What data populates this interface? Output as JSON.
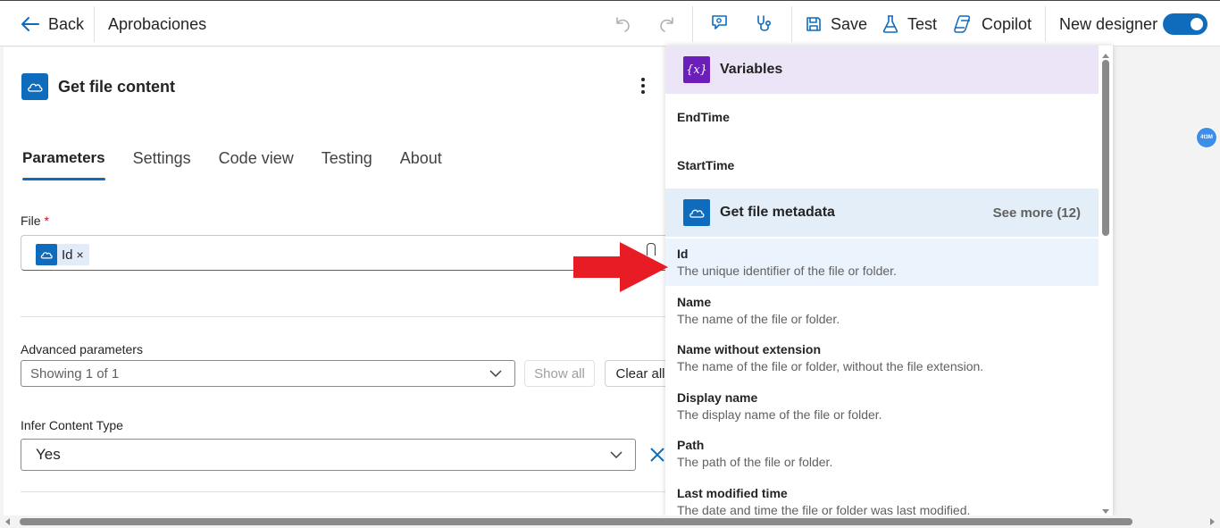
{
  "topbar": {
    "back_label": "Back",
    "title": "Aprobaciones",
    "save_label": "Save",
    "test_label": "Test",
    "copilot_label": "Copilot",
    "new_designer_label": "New designer",
    "new_designer_on": true
  },
  "card": {
    "title": "Get file content",
    "tabs": [
      {
        "label": "Parameters",
        "active": true
      },
      {
        "label": "Settings",
        "active": false
      },
      {
        "label": "Code view",
        "active": false
      },
      {
        "label": "Testing",
        "active": false
      },
      {
        "label": "About",
        "active": false
      }
    ],
    "file_label": "File",
    "file_required": "*",
    "file_token": "Id",
    "file_token_remove": "×",
    "advanced_label": "Advanced parameters",
    "advanced_value": "Showing 1 of 1",
    "show_all": "Show all",
    "clear_all": "Clear all",
    "infer_label": "Infer Content Type",
    "infer_value": "Yes"
  },
  "popup": {
    "variables_title": "Variables",
    "variables": [
      {
        "name": "EndTime"
      },
      {
        "name": "StartTime"
      }
    ],
    "metadata_title": "Get file metadata",
    "metadata_see_more": "See more (12)",
    "metadata_items": [
      {
        "name": "Id",
        "desc": "The unique identifier of the file or folder."
      },
      {
        "name": "Name",
        "desc": "The name of the file or folder."
      },
      {
        "name": "Name without extension",
        "desc": "The name of the file or folder, without the file extension."
      },
      {
        "name": "Display name",
        "desc": "The display name of the file or folder."
      },
      {
        "name": "Path",
        "desc": "The path of the file or folder."
      },
      {
        "name": "Last modified time",
        "desc": "The date and time the file or folder was last modified."
      }
    ]
  },
  "avatar_chip": "4t3M",
  "colors": {
    "accent": "#0f6cbd",
    "variables_header": "#ece4f7",
    "metadata_header": "#e4eef9",
    "arrow": "#e81c24"
  }
}
